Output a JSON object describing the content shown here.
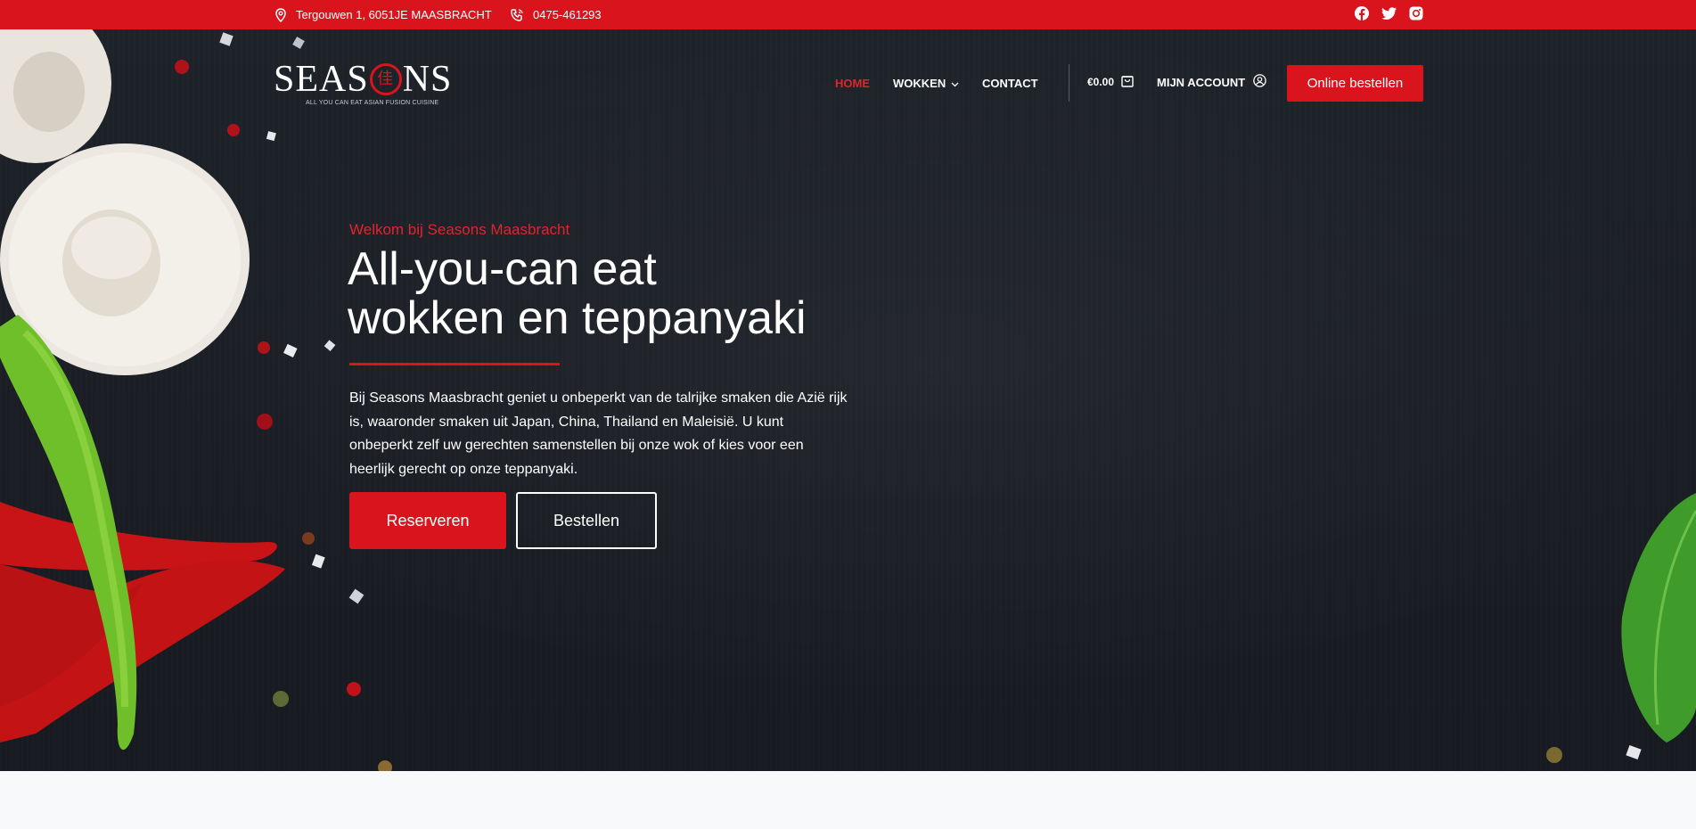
{
  "topbar": {
    "address": "Tergouwen 1, 6051JE MAASBRACHT",
    "phone": "0475-461293",
    "socials": [
      "facebook-icon",
      "twitter-icon",
      "instagram-icon"
    ]
  },
  "logo": {
    "text_left": "SEAS",
    "text_right": "NS",
    "seal_glyph": "佳",
    "tagline": "ALL YOU CAN EAT ASIAN FUSION CUISINE"
  },
  "nav": {
    "home": "HOME",
    "wokken": "WOKKEN",
    "contact": "CONTACT"
  },
  "cart": {
    "amount": "€0.00"
  },
  "account": {
    "label": "MIJN ACCOUNT"
  },
  "order_button": "Online bestellen",
  "hero": {
    "eyebrow": "Welkom bij Seasons Maasbracht",
    "headline_line1": "All-you-can eat",
    "headline_line2": "wokken en teppanyaki",
    "lead": "Bij Seasons Maasbracht geniet u onbeperkt van de talrijke smaken die Azië rijk is, waaronder smaken uit Japan, China, Thailand en Maleisië. U kunt onbeperkt zelf uw gerechten samenstellen bij onze wok of kies voor een heerlijk gerecht op onze teppanyaki.",
    "btn_reserve": "Reserveren",
    "btn_order": "Bestellen"
  },
  "colors": {
    "brand_red": "#d9141c",
    "hero_bg": "#1b1f27",
    "footer_bg": "#f8f9fb"
  }
}
